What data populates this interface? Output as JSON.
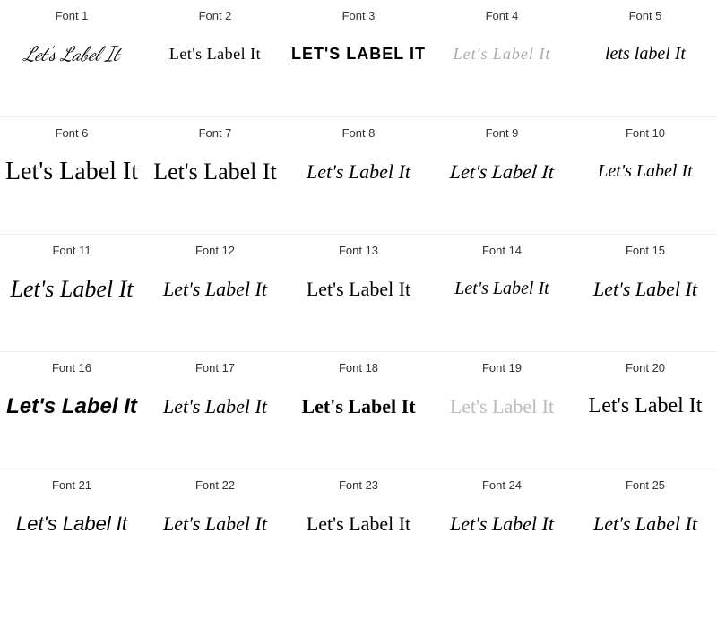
{
  "fonts": [
    {
      "id": 1,
      "label": "Font 1",
      "text": "Let's Label It",
      "class": "f1"
    },
    {
      "id": 2,
      "label": "Font 2",
      "text": "Let's Label It",
      "class": "f2"
    },
    {
      "id": 3,
      "label": "Font 3",
      "text": "LET'S LABEL IT",
      "class": "f3"
    },
    {
      "id": 4,
      "label": "Font 4",
      "text": "Let's Label It",
      "class": "f4"
    },
    {
      "id": 5,
      "label": "Font 5",
      "text": "lets label It",
      "class": "f5"
    },
    {
      "id": 6,
      "label": "Font 6",
      "text": "Let's Label It",
      "class": "f6"
    },
    {
      "id": 7,
      "label": "Font 7",
      "text": "Let's Label It",
      "class": "f7"
    },
    {
      "id": 8,
      "label": "Font 8",
      "text": "Let's Label It",
      "class": "f8"
    },
    {
      "id": 9,
      "label": "Font 9",
      "text": "Let's Label It",
      "class": "f9"
    },
    {
      "id": 10,
      "label": "Font 10",
      "text": "Let's Label It",
      "class": "f10"
    },
    {
      "id": 11,
      "label": "Font 11",
      "text": "Let's Label It",
      "class": "f11"
    },
    {
      "id": 12,
      "label": "Font 12",
      "text": "Let's Label It",
      "class": "f12"
    },
    {
      "id": 13,
      "label": "Font 13",
      "text": "Let's Label It",
      "class": "f13"
    },
    {
      "id": 14,
      "label": "Font 14",
      "text": "Let's Label It",
      "class": "f14"
    },
    {
      "id": 15,
      "label": "Font 15",
      "text": "Let's Label It",
      "class": "f15"
    },
    {
      "id": 16,
      "label": "Font 16",
      "text": "Let's Label It",
      "class": "f16"
    },
    {
      "id": 17,
      "label": "Font 17",
      "text": "Let's Label It",
      "class": "f17"
    },
    {
      "id": 18,
      "label": "Font 18",
      "text": "Let's Label It",
      "class": "f18"
    },
    {
      "id": 19,
      "label": "Font 19",
      "text": "Let's Label It",
      "class": "f19"
    },
    {
      "id": 20,
      "label": "Font 20",
      "text": "Let's Label It",
      "class": "f20"
    },
    {
      "id": 21,
      "label": "Font 21",
      "text": "Let's Label It",
      "class": "f21"
    },
    {
      "id": 22,
      "label": "Font 22",
      "text": "Let's Label It",
      "class": "f22"
    },
    {
      "id": 23,
      "label": "Font 23",
      "text": "Let's Label It",
      "class": "f23"
    },
    {
      "id": 24,
      "label": "Font 24",
      "text": "Let's Label It",
      "class": "f24"
    },
    {
      "id": 25,
      "label": "Font 25",
      "text": "Let's Label It",
      "class": "f25"
    }
  ]
}
